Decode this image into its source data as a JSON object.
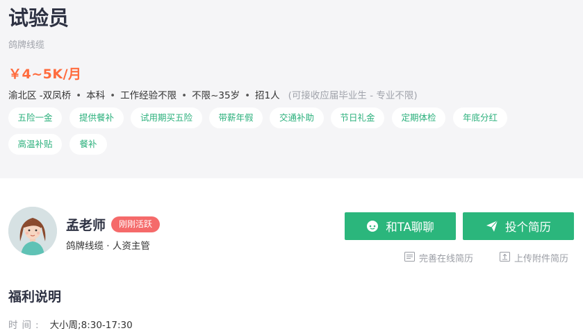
{
  "job": {
    "title": "试验员",
    "company": "鸽牌线缆",
    "salary": "￥4~5K/月",
    "location": "渝北区 -双凤桥",
    "education": "本科",
    "experience": "工作经验不限",
    "age": "不限~35岁",
    "headcount": "招1人",
    "requirement_note": "(可接收应届毕业生 - 专业不限)"
  },
  "tags": [
    "五险一金",
    "提供餐补",
    "试用期买五险",
    "带薪年假",
    "交通补助",
    "节日礼金",
    "定期体检",
    "年底分红",
    "高温补贴",
    "餐补"
  ],
  "recruiter": {
    "name": "孟老师",
    "status_badge": "刚刚活跃",
    "role": "鸽牌线缆 · 人资主管"
  },
  "actions": {
    "chat_label": "和TA聊聊",
    "apply_label": "投个简历",
    "complete_resume_label": "完善在线简历",
    "upload_attachment_label": "上传附件简历"
  },
  "benefits": {
    "section_title": "福利说明",
    "time_label": "时间:",
    "time_value": "大小周;8:30-17:30"
  },
  "colors": {
    "accent_green": "#2bb67c",
    "salary_orange": "#ff6b3d",
    "badge_red": "#f56a6a",
    "header_bg": "#f5f5f7"
  }
}
